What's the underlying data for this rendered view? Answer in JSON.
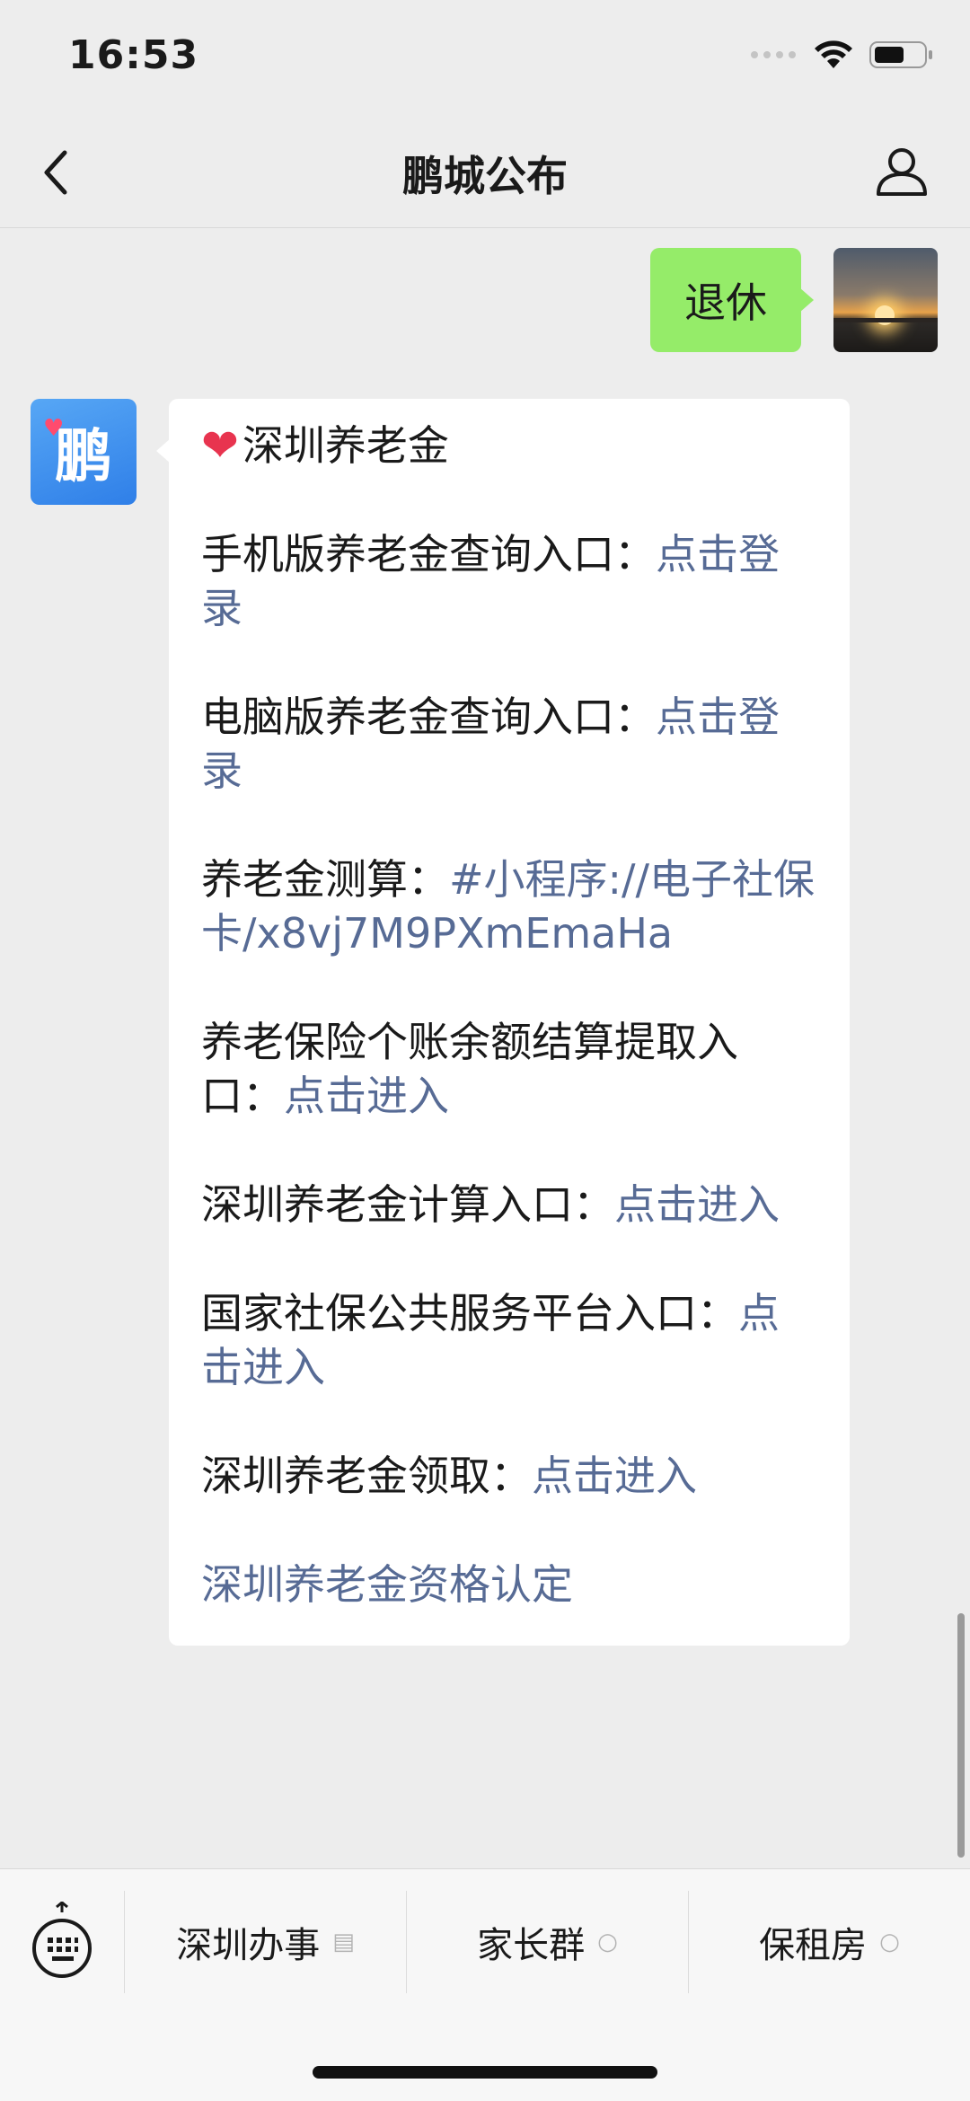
{
  "status_bar": {
    "time": "16:53"
  },
  "nav": {
    "title": "鹏城公布"
  },
  "chat": {
    "user_message": "退休",
    "bot_avatar_text": "鹏",
    "bot_heading": "深圳养老金",
    "entries": [
      {
        "label": "手机版养老金查询入口：",
        "link": "点击登录"
      },
      {
        "label": "电脑版养老金查询入口：",
        "link": "点击登录"
      },
      {
        "label": "养老金测算：",
        "link": "#小程序://电子社保卡/x8vj7M9PXmEmaHa"
      },
      {
        "label": "养老保险个账余额结算提取入口：",
        "link": "点击进入"
      },
      {
        "label": "深圳养老金计算入口：",
        "link": "点击进入"
      },
      {
        "label": "国家社保公共服务平台入口：",
        "link": "点击进入"
      },
      {
        "label": "深圳养老金领取：",
        "link": "点击进入"
      },
      {
        "label": "",
        "link": "深圳养老金资格认定"
      }
    ]
  },
  "bottom_menu": {
    "items": [
      {
        "label": "深圳办事",
        "icon": "document-icon"
      },
      {
        "label": "家长群",
        "icon": "bubble-icon"
      },
      {
        "label": "保租房",
        "icon": "bubble-icon"
      }
    ]
  },
  "colors": {
    "link": "#576b95",
    "user_bubble": "#95ec69",
    "background": "#ededed"
  }
}
